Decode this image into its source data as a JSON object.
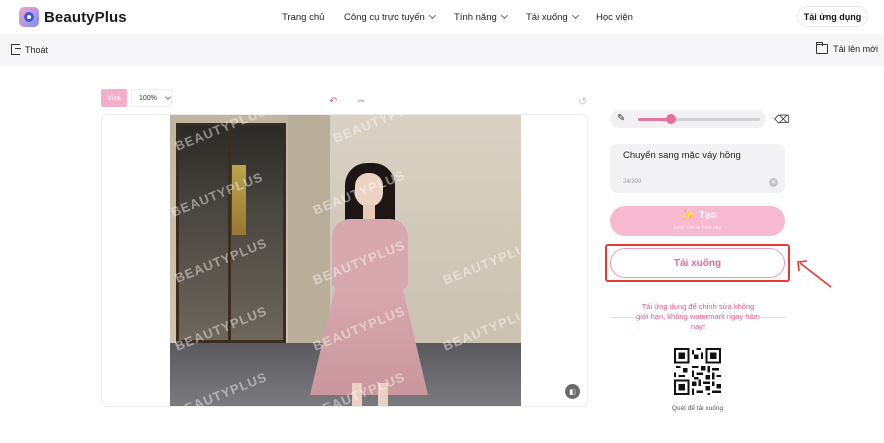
{
  "header": {
    "brand": "BeautyPlus",
    "nav": [
      {
        "label": "Trang chủ",
        "dropdown": false
      },
      {
        "label": "Công cụ trực tuyến",
        "dropdown": true
      },
      {
        "label": "Tính năng",
        "dropdown": true
      },
      {
        "label": "Tải xuống",
        "dropdown": true
      },
      {
        "label": "Học viện",
        "dropdown": false
      }
    ],
    "app_button": "Tải ứng dụng"
  },
  "subbar": {
    "exit_label": "Thoát",
    "upload_new_label": "Tải lên mới"
  },
  "canvas_toolbar": {
    "fit_label": "Vừa",
    "zoom_value": "100%",
    "icons": [
      "undo-icon",
      "redo-icon",
      "reset-icon"
    ]
  },
  "canvas": {
    "watermark_text": "BEAUTYPLUS",
    "compare_icon": "compare-icon"
  },
  "panel": {
    "brush_size_fraction": 0.27,
    "prompt_text": "Chuyển sang mặc váy hồng",
    "prompt_count": "24/300",
    "create_label": "Tạo",
    "create_sub": "Lượt còn lại hôm nay",
    "download_label": "Tải xuống",
    "promo_text": "Tải ứng dụng để chỉnh sửa không giới hạn, không watermark ngay hôm nay!",
    "qr_caption": "Quét để tải xuống"
  },
  "colors": {
    "accent": "#e86e98",
    "highlight": "#e53935",
    "fit_button": "#f3aec9"
  }
}
